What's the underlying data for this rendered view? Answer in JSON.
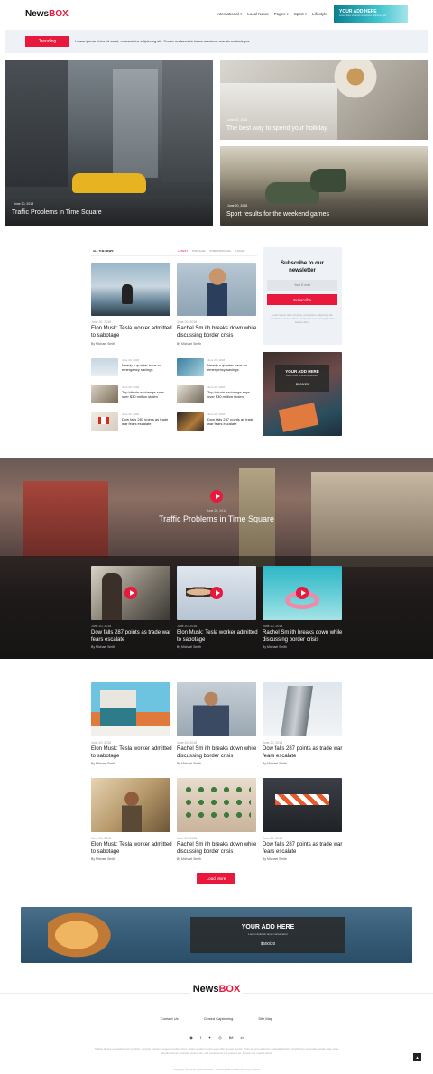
{
  "header": {
    "logo_a": "News",
    "logo_b": "BOX",
    "nav": [
      "International",
      "Local News",
      "Pages",
      "Sport",
      "Lifestyle"
    ],
    "ad_title": "YOUR ADD HERE",
    "ad_sub": "Lorem dolor sit amet consectetur adipiscing elit"
  },
  "trending": {
    "label": "Trending",
    "text": "Lorem ipsum dolor sit amet, consectetur adipiscing elit. Donec malesuada lorem maximus mauris scelerisque"
  },
  "hero": {
    "main": {
      "date": "June 20, 2018",
      "title": "Traffic Problems in Time Square"
    },
    "side1": {
      "date": "June 20, 2018",
      "title": "The best way to spend your holliday"
    },
    "side2": {
      "date": "June 20, 2018",
      "title": "Sport results for the weekend games"
    }
  },
  "allnews": {
    "heading": "ALL THE NEWS",
    "tabs": [
      "LATEST",
      "POPULAR",
      "INTERNATIONAL",
      "LOCAL"
    ],
    "big": [
      {
        "date": "June 20, 2018",
        "title": "Elon Musk: Tesla worker admitted to sabotage",
        "by": "By Michael Smith"
      },
      {
        "date": "June 20, 2018",
        "title": "Rachel Sm ith breaks down while discussing border crisis",
        "by": "By Michael Smith"
      }
    ],
    "small": [
      {
        "date": "June 20, 2018",
        "title": "Nearly a quarter have no emergency savings"
      },
      {
        "date": "June 20, 2018",
        "title": "Nearly a quarter have no emergency savings"
      },
      {
        "date": "June 20, 2018",
        "title": "Top bitcoin exchange says over $30 million stolen"
      },
      {
        "date": "June 20, 2018",
        "title": "Top bitcoin exchange says over $30 million stolen"
      },
      {
        "date": "June 20, 2018",
        "title": "Dow falls 287 points as trade war fears escalate"
      },
      {
        "date": "June 20, 2018",
        "title": "Dow falls 287 points as trade war fears escalate"
      }
    ]
  },
  "newsletter": {
    "title": "Subscribe to our newsletter",
    "placeholder": "Your E-mail",
    "button": "Subscribe",
    "note": "Lorem ipsum dolor sit amet, consectetur adipiscing elit. Vestibulum lacinia, diam a tempus consectetur, ligula nisl laoreet diam."
  },
  "side_ad": {
    "title": "YOUR ADD HERE",
    "sub": "Lorem dolor sit amet consectetur",
    "price": "$600/20"
  },
  "video": {
    "date": "June 20, 2018",
    "title": "Traffic Problems in Time Square",
    "items": [
      {
        "date": "June 20, 2018",
        "title": "Dow falls 287 points as trade war fears escalate",
        "by": "By Michael Smith"
      },
      {
        "date": "June 20, 2018",
        "title": "Elon Musk: Tesla worker admitted to sabotage",
        "by": "By Michael Smith"
      },
      {
        "date": "June 20, 2018",
        "title": "Rachel Sm ith breaks down while discussing border crisis",
        "by": "By Michael Smith"
      }
    ]
  },
  "grid": [
    {
      "date": "June 20, 2018",
      "title": "Elon Musk: Tesla worker admitted to sabotage",
      "by": "By Michael Smith"
    },
    {
      "date": "June 20, 2018",
      "title": "Rachel Sm ith breaks down while discussing border crisis",
      "by": "By Michael Smith"
    },
    {
      "date": "June 20, 2018",
      "title": "Dow falls 287 points as trade war fears escalate",
      "by": "By Michael Smith"
    },
    {
      "date": "June 20, 2018",
      "title": "Elon Musk: Tesla worker admitted to sabotage",
      "by": "By Michael Smith"
    },
    {
      "date": "June 20, 2018",
      "title": "Rachel Sm ith breaks down while discussing border crisis",
      "by": "By Michael Smith"
    },
    {
      "date": "June 20, 2018",
      "title": "Dow falls 287 points as trade war fears escalate",
      "by": "By Michael Smith"
    }
  ],
  "load_more": "Load More",
  "banner": {
    "title": "YOUR ADD HERE",
    "sub": "Lorem dolor sit amet consectetur",
    "price": "$600/20"
  },
  "footer": {
    "logo_a": "News",
    "logo_b": "BOX",
    "links": [
      "Contact Us",
      "Closed Captioning",
      "Site Map"
    ],
    "social": [
      "pinterest-icon",
      "facebook-icon",
      "twitter-icon",
      "dribbble-icon",
      "behance-icon",
      "linkedin-icon"
    ],
    "about": "Nullam lacinia ex eleifend orci porttitor, suscipit interdum augue condimentum. Etiam pretium turpis eget nibh laoreet iaculis. Proin ac urna at lectus volutpat lobortis. Vestibulum venenatis iaculis diam vitae lobortis. Donec tincidunt viverra elit, sed consectetur est pretium ac. Mauris nec mauris tellus.",
    "copyright": "Copyright ©2019 All rights reserved | This template is made with ♥ by Colorlib"
  },
  "colors": {
    "accent": "#e8193c",
    "dark": "#1b1b1b",
    "light_bg": "#eef1f5"
  }
}
